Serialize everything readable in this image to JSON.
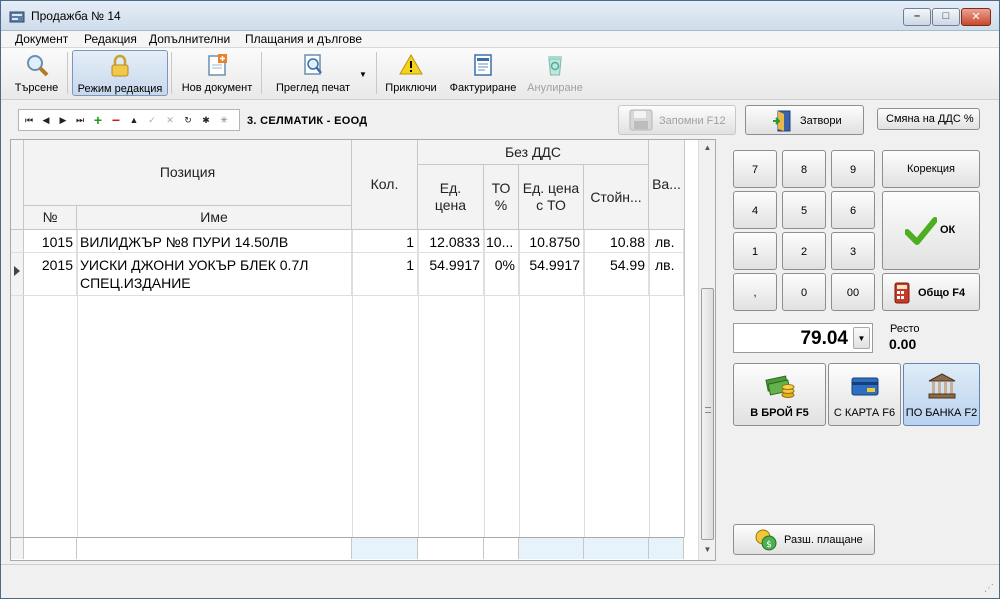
{
  "window": {
    "title": "Продажба № 14"
  },
  "menu": [
    "Документ",
    "Редакция",
    "Допълнителни",
    "Плащания и дългове"
  ],
  "toolbar": {
    "search": "Търсене",
    "edit_mode": "Режим редакция",
    "new_doc": "Нов документ",
    "print_preview": "Преглед печат",
    "finish": "Приключи",
    "invoice": "Фактуриране",
    "cancel": "Анулиране"
  },
  "company": "3. СЕЛМАТИК - ЕООД",
  "buttons": {
    "save": "Запомни  F12",
    "close": "Затвори",
    "vat_change": "Смяна на ДДС %"
  },
  "grid": {
    "headers": {
      "position": "Позиция",
      "no": "№",
      "name": "Име",
      "qty": "Кол.",
      "no_vat": "Без ДДС",
      "unit_price": "Ед. цена",
      "to_pct": "ТО %",
      "unit_price_to": "Ед. цена с ТО",
      "value": "Стойн...",
      "currency": "Ва..."
    },
    "rows": [
      {
        "no": "1015",
        "name": "ВИЛИДЖЪР №8 ПУРИ 14.50ЛВ",
        "name2": "",
        "qty": "1",
        "unit_price": "12.0833",
        "to_pct": "10...",
        "unit_price_to": "10.8750",
        "value": "10.88",
        "currency": "лв."
      },
      {
        "no": "2015",
        "name": "УИСКИ ДЖОНИ УОКЪР БЛЕК 0.7Л",
        "name2": "СПЕЦ.ИЗДАНИЕ",
        "qty": "1",
        "unit_price": "54.9917",
        "to_pct": "0%",
        "unit_price_to": "54.9917",
        "value": "54.99",
        "currency": "лв."
      }
    ]
  },
  "keypad": {
    "keys": [
      "7",
      "8",
      "9",
      "4",
      "5",
      "6",
      "1",
      "2",
      "3",
      ",",
      "0",
      "00"
    ],
    "correction": "Корекция",
    "ok": "ОК",
    "total": "Общо  F4"
  },
  "amount": "79.04",
  "change": {
    "label": "Ресто",
    "value": "0.00"
  },
  "payments": {
    "cash": "В БРОЙ  F5",
    "card": "С КАРТА  F6",
    "bank": "ПО БАНКА F2",
    "extended": "Разш. плащане"
  },
  "colors": {
    "accent": "#b9d2ee",
    "ok_green": "#4caf1f",
    "titlebar": "#cfdcea"
  }
}
